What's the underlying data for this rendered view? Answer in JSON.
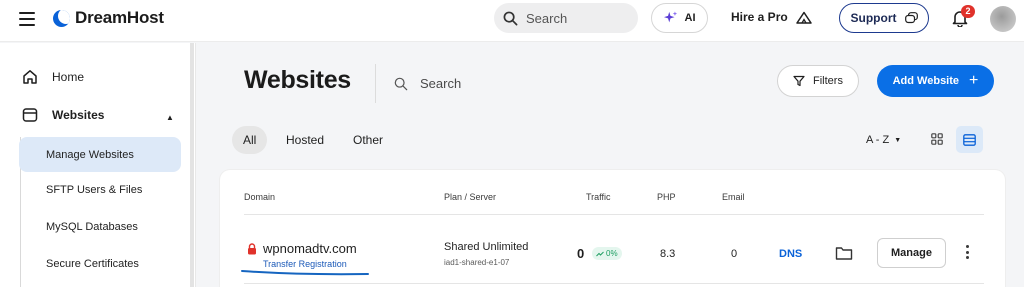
{
  "header": {
    "brand": "DreamHost",
    "search_placeholder": "Search",
    "ai_label": "AI",
    "hire_pro_label": "Hire a Pro",
    "support_label": "Support",
    "notification_count": "2",
    "icons": {
      "menu": "hamburger-icon",
      "search": "search-icon",
      "ai": "sparkle-icon",
      "hire": "tent-icon",
      "support": "chat-icon",
      "bell": "bell-icon"
    }
  },
  "sidebar": {
    "items": [
      {
        "label": "Home",
        "icon": "home-icon"
      },
      {
        "label": "Websites",
        "icon": "window-icon",
        "expanded": true
      }
    ],
    "subitems": [
      {
        "label": "Manage Websites",
        "active": true
      },
      {
        "label": "SFTP Users & Files"
      },
      {
        "label": "MySQL Databases"
      },
      {
        "label": "Secure Certificates"
      }
    ]
  },
  "main": {
    "title": "Websites",
    "search_placeholder": "Search",
    "filters_label": "Filters",
    "add_website_label": "Add Website",
    "tabs": [
      {
        "label": "All",
        "active": true
      },
      {
        "label": "Hosted"
      },
      {
        "label": "Other"
      }
    ],
    "sort_label": "A - Z",
    "view_mode": "list"
  },
  "table": {
    "columns": [
      "Domain",
      "Plan / Server",
      "Traffic",
      "PHP",
      "Email"
    ],
    "rows": [
      {
        "domain": "wpnomadtv.com",
        "transfer_label": "Transfer Registration",
        "plan": "Shared Unlimited",
        "server": "iad1-shared-e1-07",
        "traffic": "0",
        "traffic_change": "0%",
        "php": "8.3",
        "email": "0",
        "dns_label": "DNS",
        "manage_label": "Manage"
      }
    ]
  },
  "colors": {
    "accent": "#0a6fe6",
    "active_bg": "#dde9f8",
    "badge": "#e0322b",
    "positive": "#1e9e62"
  }
}
